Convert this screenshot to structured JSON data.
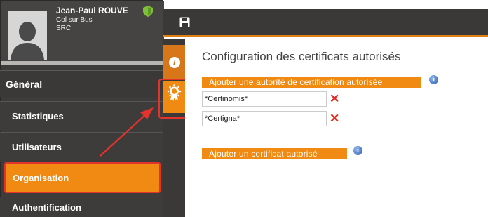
{
  "profile": {
    "name": "Jean-Paul ROUVE",
    "line1": "Col sur Bus",
    "line2": "SRCI"
  },
  "nav": {
    "general": "Général",
    "items": [
      {
        "label": "Statistiques"
      },
      {
        "label": "Utilisateurs"
      },
      {
        "label": "Organisation"
      },
      {
        "label": "Authentification"
      }
    ]
  },
  "main": {
    "title": "Configuration des certificats autorisés",
    "add_authority_label": "Ajouter une autorité de certification autorisée",
    "authorities": [
      "*Certinomis*",
      "*Certigna*"
    ],
    "add_certificate_label": "Ajouter un certificat autorisé"
  },
  "icons": {
    "info_glyph": "i",
    "delete_glyph": "✕"
  },
  "colors": {
    "accent": "#f08a12",
    "sidebar": "#3d3c3b",
    "annotation": "#e3332c",
    "delete": "#e22a1f"
  }
}
